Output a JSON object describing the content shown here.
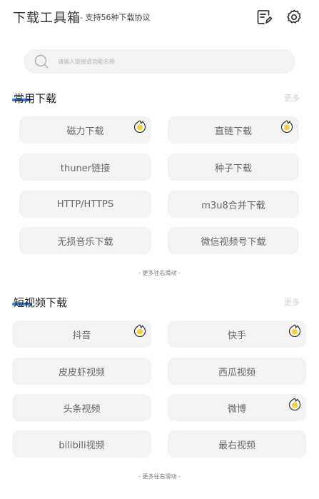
{
  "header": {
    "title": "下载工具箱",
    "subtitle": "- 支持56种下载协议",
    "icons": [
      "notes-edit-icon",
      "settings-icon"
    ]
  },
  "search": {
    "placeholder": "请输入链接或功能名称",
    "icon": "search-icon"
  },
  "sections": [
    {
      "title": "常用下载",
      "more": "更多",
      "items": [
        {
          "label": "磁力下载",
          "hot": true
        },
        {
          "label": "直链下载",
          "hot": true
        },
        {
          "label": "thuner链接",
          "hot": false
        },
        {
          "label": "种子下载",
          "hot": false
        },
        {
          "label": "HTTP/HTTPS",
          "hot": false
        },
        {
          "label": "m3u8合并下载",
          "hot": false
        },
        {
          "label": "无损音乐下载",
          "hot": false
        },
        {
          "label": "微信视频号下载",
          "hot": false
        }
      ],
      "scroll_hint": "- 更多往右滑动 -"
    },
    {
      "title": "短视频下载",
      "more": "更多",
      "items": [
        {
          "label": "抖音",
          "hot": true
        },
        {
          "label": "快手",
          "hot": true
        },
        {
          "label": "皮皮虾视频",
          "hot": false
        },
        {
          "label": "西瓜视频",
          "hot": false
        },
        {
          "label": "头条视频",
          "hot": false
        },
        {
          "label": "微博",
          "hot": true
        },
        {
          "label": "bilibili视频",
          "hot": false
        },
        {
          "label": "最右视频",
          "hot": false
        }
      ],
      "scroll_hint": "- 更多往右滑动 -"
    }
  ],
  "colors": {
    "accent": "#3a7bd5",
    "tile_bg": "#f3f3f3",
    "hot_badge": "#f5cf3a"
  }
}
